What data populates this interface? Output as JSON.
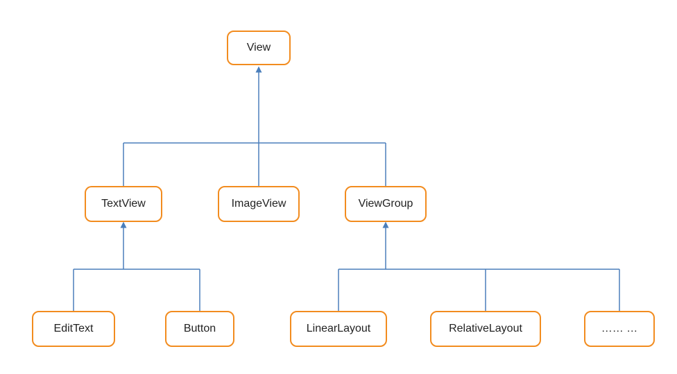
{
  "diagram": {
    "nodes": {
      "view": "View",
      "textview": "TextView",
      "imageview": "ImageView",
      "viewgroup": "ViewGroup",
      "edittext": "EditText",
      "button": "Button",
      "linearlayout": "LinearLayout",
      "relativelayout": "RelativeLayout",
      "ellipsis": "…… …"
    },
    "hierarchy": {
      "root": "View",
      "children": {
        "View": [
          "TextView",
          "ImageView",
          "ViewGroup"
        ],
        "TextView": [
          "EditText",
          "Button"
        ],
        "ViewGroup": [
          "LinearLayout",
          "RelativeLayout",
          "…… …"
        ]
      }
    },
    "colors": {
      "node_border": "#f28c1f",
      "edge": "#4a7ebb",
      "background": "#ffffff"
    }
  }
}
